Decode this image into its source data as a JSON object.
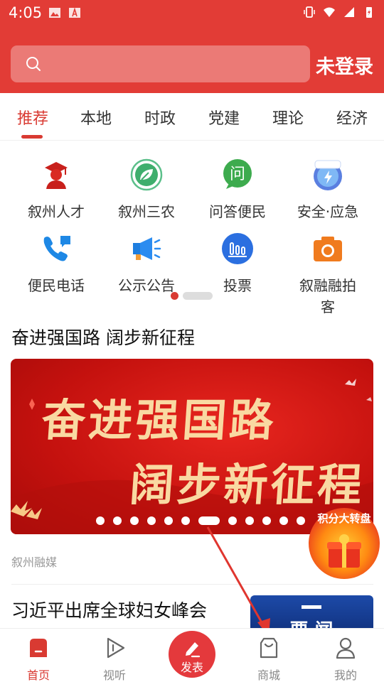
{
  "status_bar": {
    "time": "4:05"
  },
  "header": {
    "search_placeholder": "",
    "login_label": "未登录"
  },
  "tabs": [
    "推荐",
    "本地",
    "时政",
    "党建",
    "理论",
    "经济"
  ],
  "grid": [
    {
      "label": "叙州人才",
      "icon": "graduate-person-icon"
    },
    {
      "label": "叙州三农",
      "icon": "leaf-icon"
    },
    {
      "label": "问答便民",
      "icon": "question-bubble-icon"
    },
    {
      "label": "安全·应急",
      "icon": "safety-emergency-icon",
      "badge": "安全·应急"
    },
    {
      "label": "便民电话",
      "icon": "phone-icon"
    },
    {
      "label": "公示公告",
      "icon": "megaphone-icon"
    },
    {
      "label": "投票",
      "icon": "vote-icon"
    },
    {
      "label": "叙融融拍客",
      "icon": "camera-icon"
    }
  ],
  "section": {
    "title": "奋进强国路 阔步新征程",
    "banner_line1": "奋进强国路",
    "banner_line2": "阔步新征程",
    "banner_slide_count": 12,
    "banner_active_index": 6,
    "source": "叙州融媒"
  },
  "news": {
    "title": "习近平出席全球妇女峰会",
    "thumb_text": "要 闻"
  },
  "float_badge": {
    "text": "积分大转盘"
  },
  "bottom_nav": [
    {
      "label": "首页",
      "icon": "home-icon"
    },
    {
      "label": "视听",
      "icon": "play-icon"
    },
    {
      "label": "发表",
      "icon": "pen-icon"
    },
    {
      "label": "商城",
      "icon": "shopping-bag-icon"
    },
    {
      "label": "我的",
      "icon": "user-icon"
    }
  ],
  "colors": {
    "brand": "#e23c36",
    "accent": "#d93a32",
    "banner_text": "#f9d9a2"
  }
}
